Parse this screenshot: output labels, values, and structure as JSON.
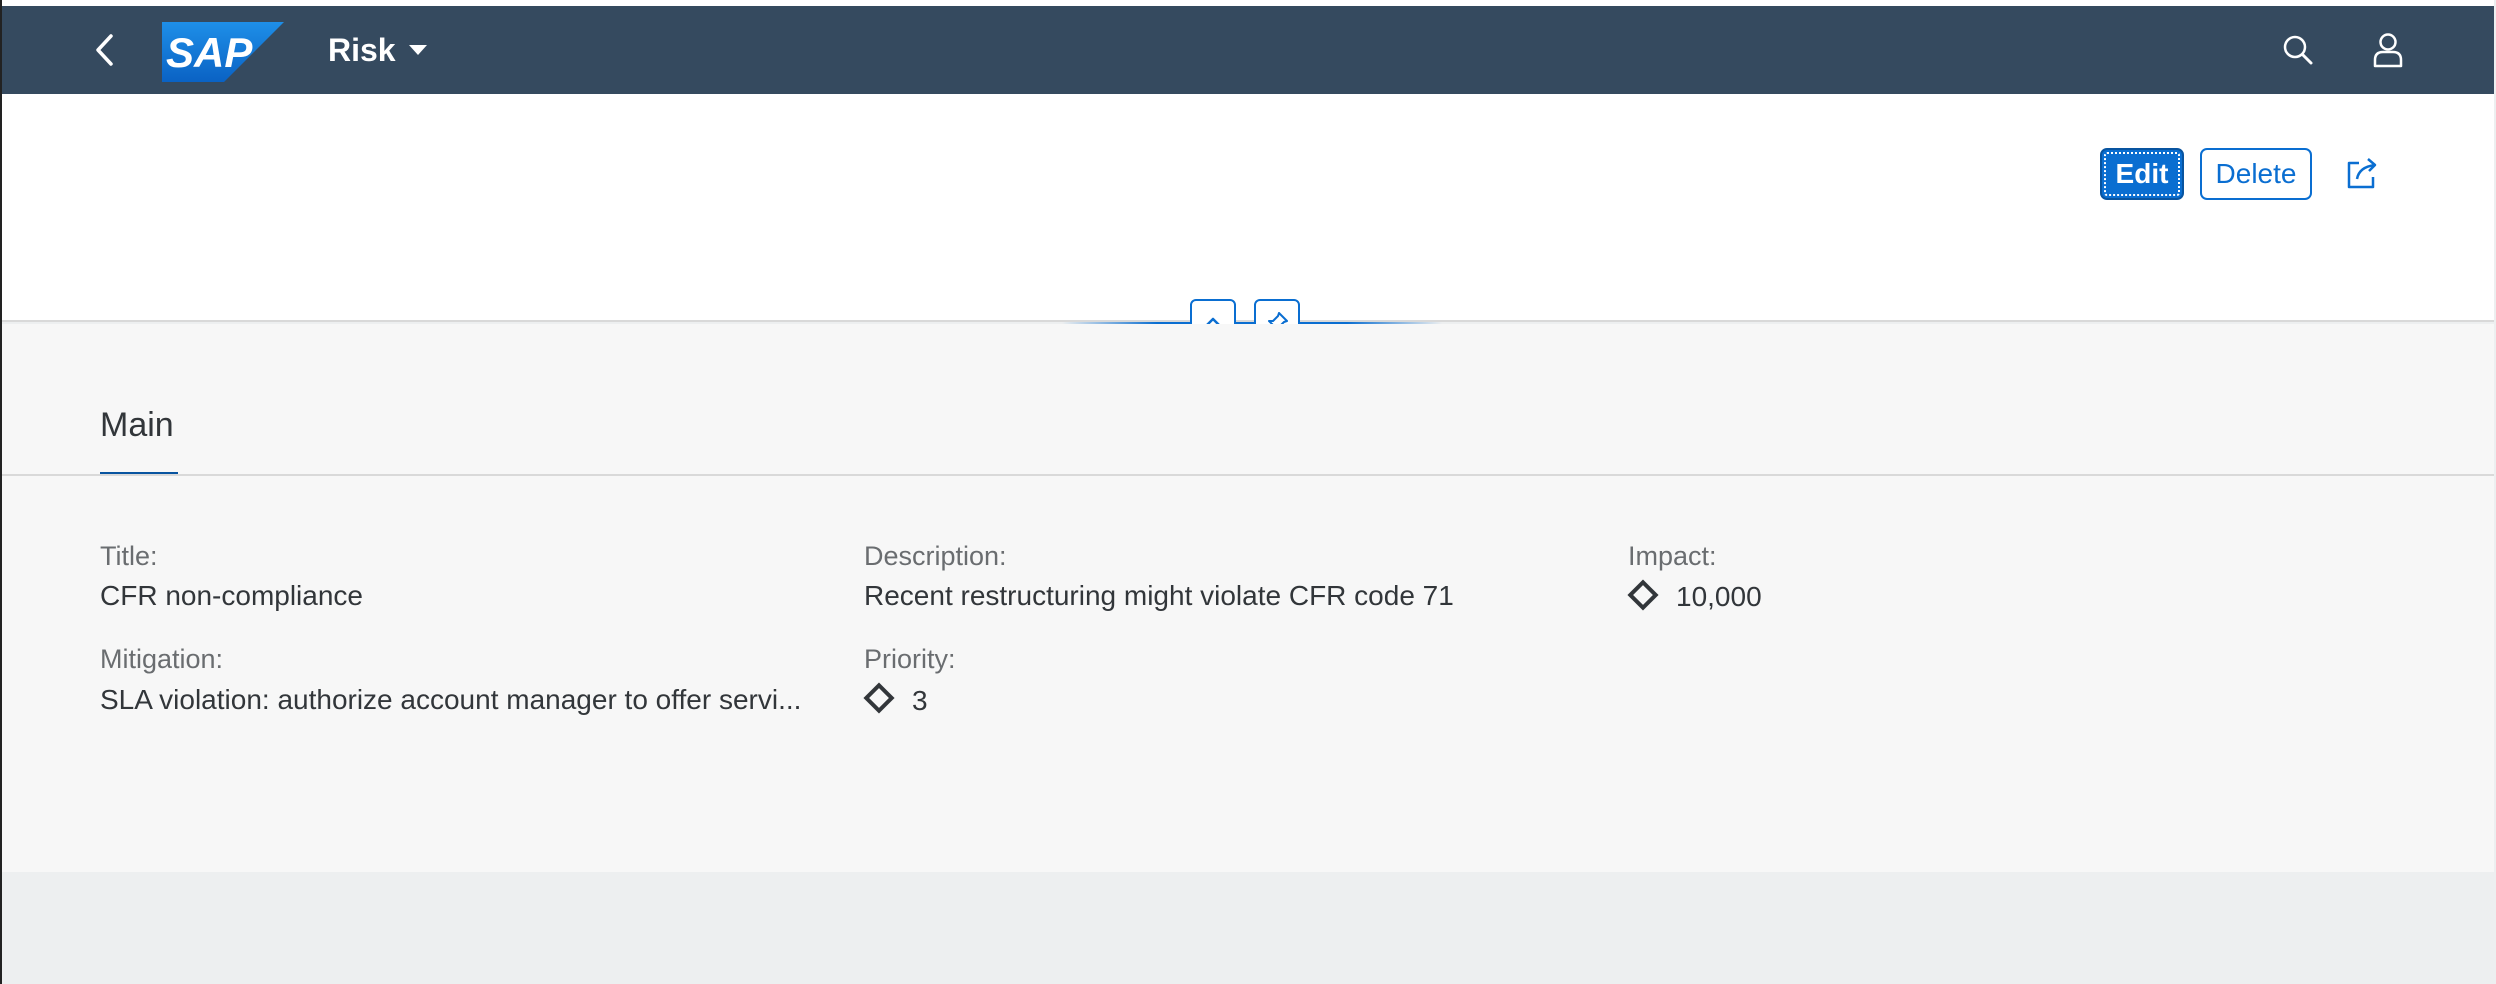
{
  "shell": {
    "title": "Risk",
    "logo_text": "SAP",
    "back_icon": "chevron-left-icon",
    "dropdown_icon": "caret-down-icon",
    "search_icon": "search-icon",
    "user_icon": "user-icon"
  },
  "header": {
    "edit_label": "Edit",
    "delete_label": "Delete",
    "share_icon": "share-icon",
    "collapse_icon": "chevron-up-icon",
    "pin_icon": "pin-icon"
  },
  "tabs": [
    {
      "label": "Main",
      "selected": true
    }
  ],
  "fields": {
    "title_label": "Title:",
    "title_value": "CFR non-compliance",
    "description_label": "Description:",
    "description_value": "Recent restructuring might violate CFR code 71",
    "impact_label": "Impact:",
    "impact_value": "10,000",
    "mitigation_label": "Mitigation:",
    "mitigation_value": "SLA violation: authorize account manager to offer servi...",
    "priority_label": "Priority:",
    "priority_value": "3"
  },
  "colors": {
    "shell_bg": "#354a5f",
    "accent": "#0a6ed1",
    "content_bg": "#f7f7f7"
  }
}
